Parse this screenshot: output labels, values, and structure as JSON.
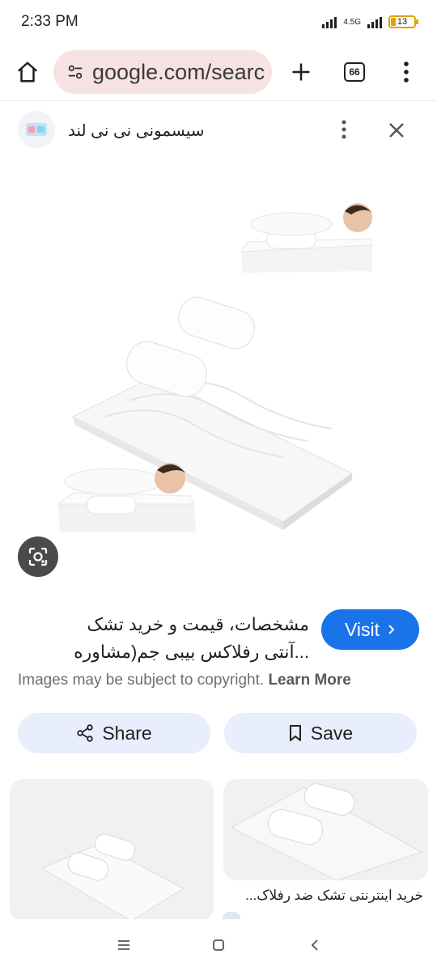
{
  "status_bar": {
    "time": "2:33 PM",
    "network": "4.5G",
    "battery": "13"
  },
  "browser": {
    "url": "google.com/searc",
    "tab_count": "66",
    "icons": {
      "home": "home-icon",
      "site_info": "tune-icon",
      "new_tab": "plus-icon",
      "tabs": "tab-switcher-icon",
      "menu": "more-vert-icon"
    }
  },
  "panel": {
    "site_name": "سیسمونی نی نی لند",
    "title_line1": "مشخصات، قیمت و خرید تشک",
    "title_line2": "...آنتی رفلاکس بیبی جم(مشاوره",
    "visit_label": "Visit",
    "copyright_text": "Images may be subject to copyright.",
    "learn_more": "Learn More",
    "share_label": "Share",
    "save_label": "Save"
  },
  "related": [
    {
      "caption": ""
    },
    {
      "caption": "خرید اینترنتی تشک ضد رفلاک..."
    }
  ],
  "colors": {
    "accent": "#1a73e8",
    "pill": "#e8eefc",
    "omnibox": "#f6e2e2"
  }
}
